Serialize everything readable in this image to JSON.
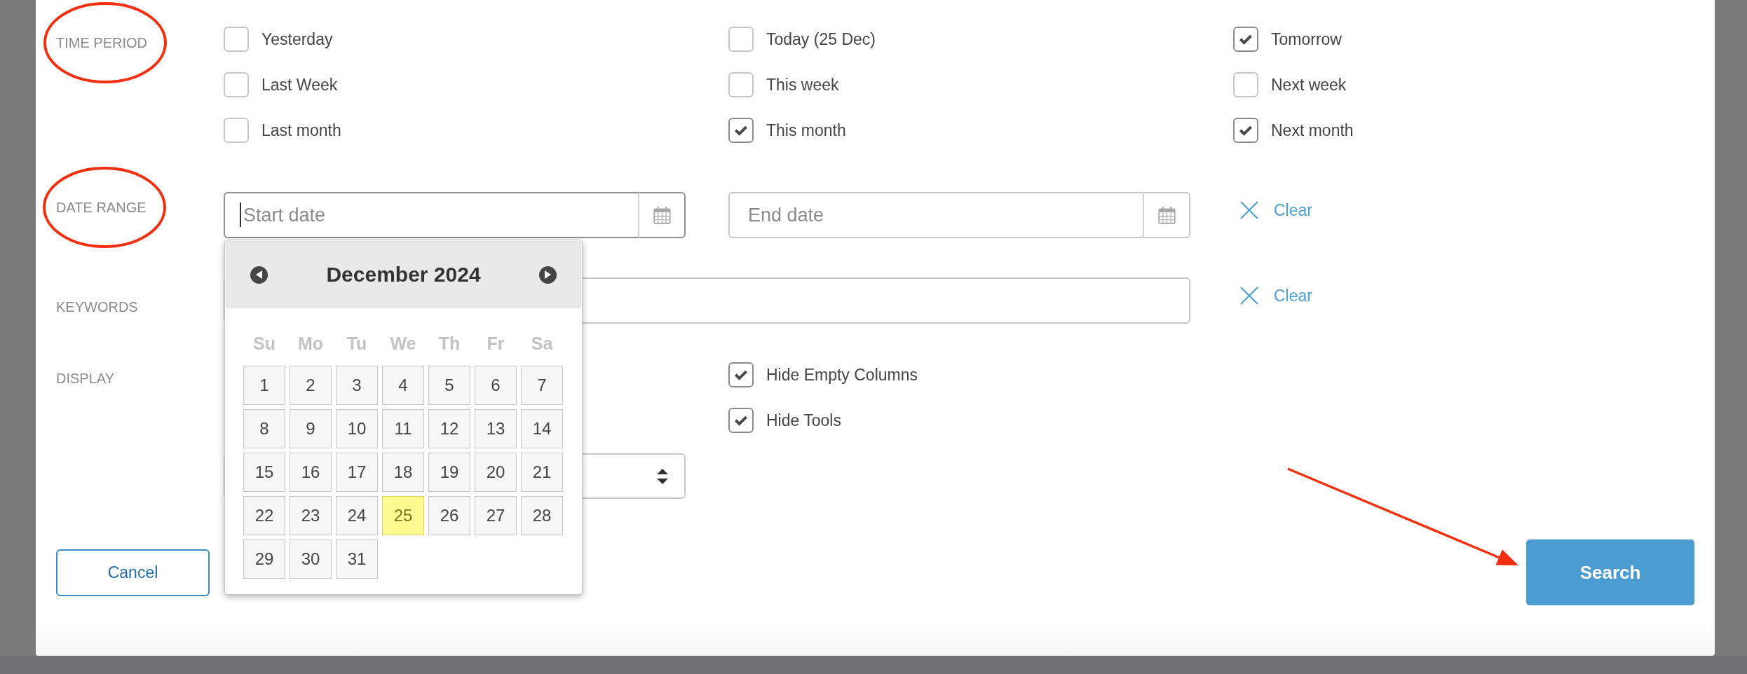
{
  "sections": [
    {
      "kind": "checkboxes",
      "label": "TIME PERIOD",
      "circled": true,
      "options": [
        {
          "label": "Yesterday",
          "checked": false
        },
        {
          "label": "Today (25 Dec)",
          "checked": false
        },
        {
          "label": "Tomorrow",
          "checked": true
        },
        {
          "label": "Last Week",
          "checked": false
        },
        {
          "label": "This week",
          "checked": false
        },
        {
          "label": "Next week",
          "checked": false
        },
        {
          "label": "Last month",
          "checked": false
        },
        {
          "label": "This month",
          "checked": true
        },
        {
          "label": "Next month",
          "checked": true
        }
      ]
    },
    {
      "kind": "date_range",
      "label": "DATE RANGE",
      "circled": true,
      "start": {
        "placeholder": "Start date",
        "focused": true,
        "calendar": {
          "title": "December 2024",
          "weekdays": [
            "Su",
            "Mo",
            "Tu",
            "We",
            "Th",
            "Fr",
            "Sa"
          ],
          "days": [
            {
              "label": "1",
              "highlighted": false
            },
            {
              "label": "2",
              "highlighted": false
            },
            {
              "label": "3",
              "highlighted": false
            },
            {
              "label": "4",
              "highlighted": false
            },
            {
              "label": "5",
              "highlighted": false
            },
            {
              "label": "6",
              "highlighted": false
            },
            {
              "label": "7",
              "highlighted": false
            },
            {
              "label": "8",
              "highlighted": false
            },
            {
              "label": "9",
              "highlighted": false
            },
            {
              "label": "10",
              "highlighted": false
            },
            {
              "label": "11",
              "highlighted": false
            },
            {
              "label": "12",
              "highlighted": false
            },
            {
              "label": "13",
              "highlighted": false
            },
            {
              "label": "14",
              "highlighted": false
            },
            {
              "label": "15",
              "highlighted": false
            },
            {
              "label": "16",
              "highlighted": false
            },
            {
              "label": "17",
              "highlighted": false
            },
            {
              "label": "18",
              "highlighted": false
            },
            {
              "label": "19",
              "highlighted": false
            },
            {
              "label": "20",
              "highlighted": false
            },
            {
              "label": "21",
              "highlighted": false
            },
            {
              "label": "22",
              "highlighted": false
            },
            {
              "label": "23",
              "highlighted": false
            },
            {
              "label": "24",
              "highlighted": false
            },
            {
              "label": "25",
              "highlighted": true
            },
            {
              "label": "26",
              "highlighted": false
            },
            {
              "label": "27",
              "highlighted": false
            },
            {
              "label": "28",
              "highlighted": false
            },
            {
              "label": "29",
              "highlighted": false
            },
            {
              "label": "30",
              "highlighted": false
            },
            {
              "label": "31",
              "highlighted": false
            }
          ]
        }
      },
      "end": {
        "placeholder": "End date",
        "focused": false
      },
      "clear": "Clear"
    },
    {
      "kind": "keywords",
      "label": "KEYWORDS",
      "circled": false,
      "clear": "Clear"
    },
    {
      "kind": "display",
      "label": "DISPLAY",
      "circled": false,
      "options": [
        {
          "label": "Hide Empty Columns",
          "checked": true
        },
        {
          "label": "Hide Tools",
          "checked": true
        }
      ]
    }
  ],
  "buttons": [
    {
      "kind": "cancel",
      "label": "Cancel"
    },
    {
      "kind": "search",
      "label": "Search",
      "arrow": true
    }
  ]
}
